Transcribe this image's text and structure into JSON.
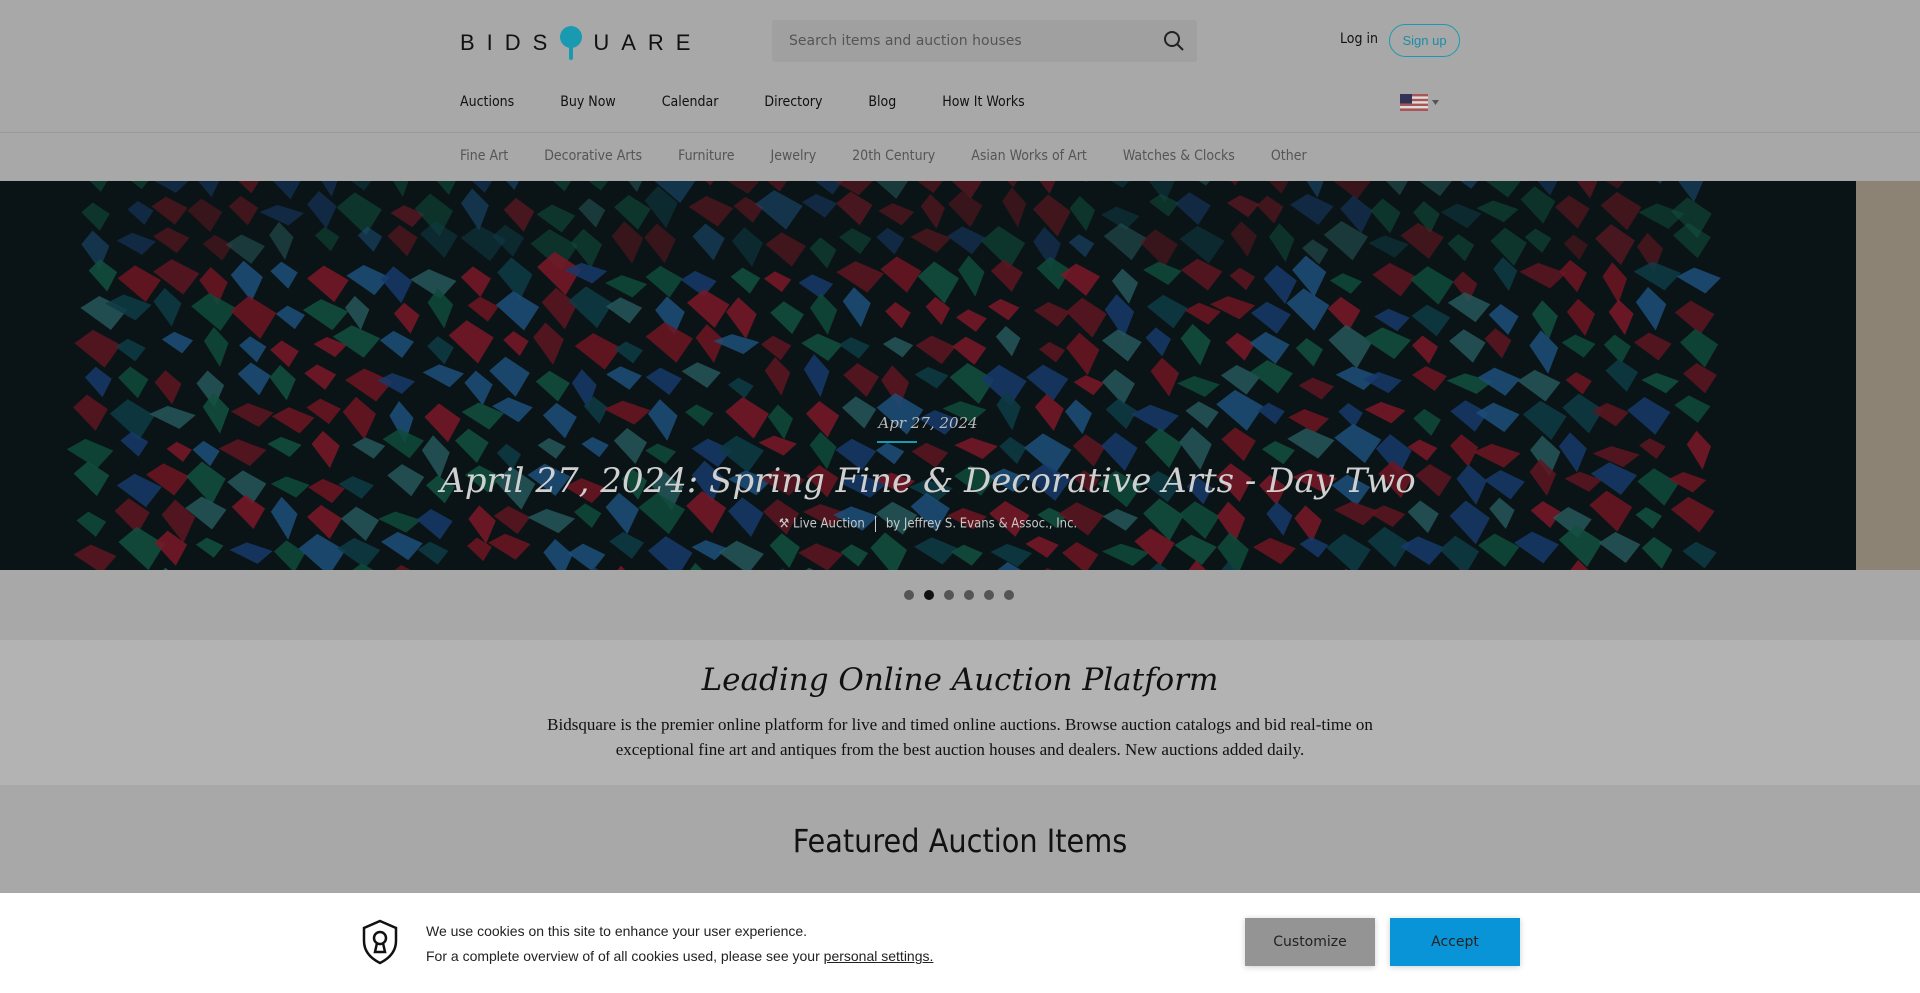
{
  "header": {
    "logo": "BIDSQUARE",
    "search_placeholder": "Search items and auction houses",
    "login": "Log in",
    "signup": "Sign up",
    "accent": "#1a9ab0"
  },
  "nav": [
    "Auctions",
    "Buy Now",
    "Calendar",
    "Directory",
    "Blog",
    "How It Works"
  ],
  "categories": [
    "Fine Art",
    "Decorative Arts",
    "Furniture",
    "Jewelry",
    "20th Century",
    "Asian Works of Art",
    "Watches & Clocks",
    "Other"
  ],
  "hero": {
    "date": "Apr 27, 2024",
    "title": "April 27, 2024: Spring Fine & Decorative Arts - Day Two",
    "type": "Live Auction",
    "by": "by Jeffrey S. Evans & Assoc., Inc.",
    "slides": 6,
    "active_slide": 2
  },
  "intro": {
    "title": "Leading Online Auction Platform",
    "text": "Bidsquare is the premier online platform for live and timed online auctions. Browse auction catalogs and bid real-time on exceptional fine art and antiques from the best auction houses and dealers. New auctions added daily."
  },
  "featured": {
    "title": "Featured Auction Items"
  },
  "cookie": {
    "line1": "We use cookies on this site to enhance your user experience.",
    "line2": "For a complete overview of of all cookies used, please see your ",
    "link": "personal settings.",
    "customize": "Customize",
    "accept": "Accept",
    "accept_color": "#0a94d8"
  }
}
